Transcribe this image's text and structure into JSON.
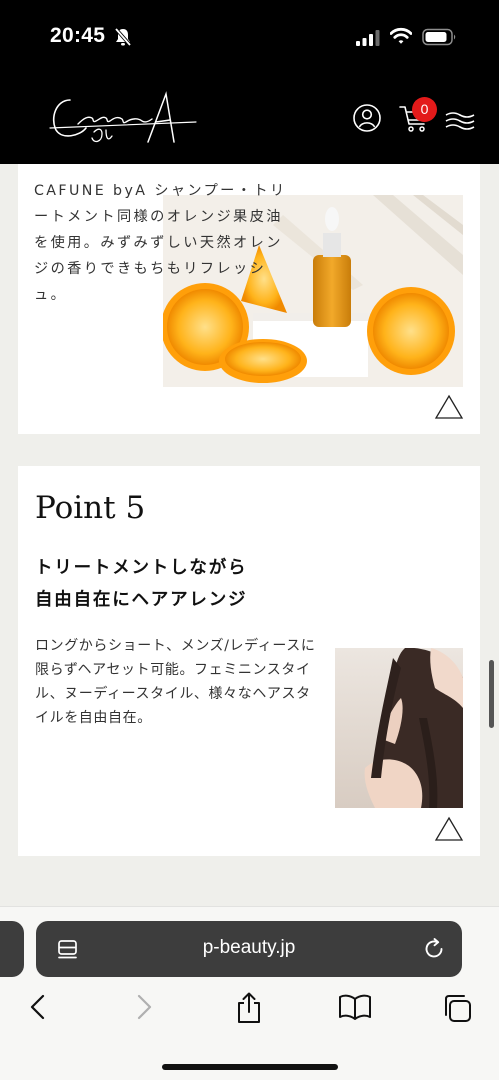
{
  "status_bar": {
    "time": "20:45",
    "icons": [
      "bell-muted-icon",
      "cellular-signal-icon",
      "wifi-icon",
      "battery-icon"
    ]
  },
  "header": {
    "logo_alt": "Cafune by A",
    "cart_count": "0",
    "icons": [
      "account-icon",
      "cart-icon",
      "menu-icon"
    ],
    "badge_color": "#e31a1a"
  },
  "card_top": {
    "text": "CAFUNE byA シャンプー・トリートメント同様のオレンジ果皮油を使用。みずみずしい天然オレンジの香りできもちもリフレッシュ。",
    "image": "orange-oil-photo"
  },
  "point5": {
    "heading": "Point 5",
    "subhead_line1": "トリートメントしながら",
    "subhead_line2": "自由自在にヘアアレンジ",
    "body": "ロングからショート、メンズ/レディースに限らずヘアセット可能。フェミニンスタイル、ヌーディースタイル、様々なヘアスタイルを自由自在。",
    "image": "long-hair-woman-photo"
  },
  "browser": {
    "url": "p-beauty.jp",
    "toolbar": [
      "back-icon",
      "forward-icon",
      "share-icon",
      "bookmarks-icon",
      "tabs-icon"
    ]
  },
  "colors": {
    "header_bg": "#000000",
    "page_bg": "#efefeb",
    "card_bg": "#ffffff",
    "address_bar_bg": "#3d3d3d"
  }
}
